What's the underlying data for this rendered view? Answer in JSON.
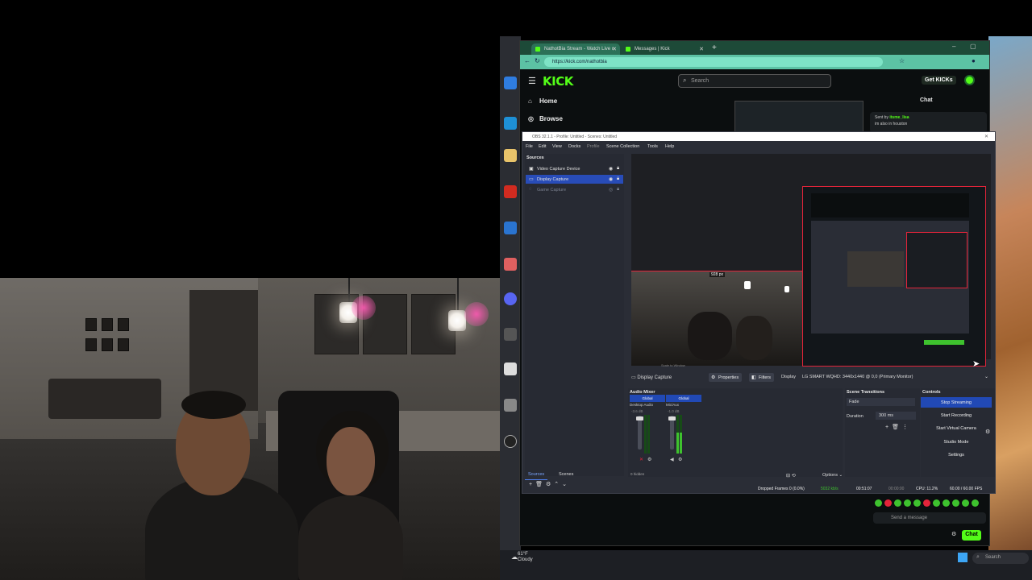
{
  "browser": {
    "tabs": [
      {
        "title": "NathotBia Stream - Watch Live o"
      },
      {
        "title": "Messages | Kick"
      }
    ],
    "url": "https://kick.com/nathotbia",
    "logo": "KICK",
    "search_placeholder": "Search",
    "get_kicks": "Get KICKs",
    "nav": [
      {
        "label": "Home",
        "icon": "home-icon"
      },
      {
        "label": "Browse",
        "icon": "compass-icon"
      }
    ],
    "chat": {
      "title": "Chat",
      "pinned_sender_prefix": "Sent by",
      "pinned_sender": "itsme_lisa",
      "pinned_message": "im also in houston",
      "input_placeholder": "Send a message",
      "chat_button": "Chat"
    }
  },
  "obs": {
    "title": "OBS 32.1.1 - Profile: Untitled - Scenes: Untitled",
    "menu": [
      "File",
      "Edit",
      "View",
      "Docks",
      "Profile",
      "Scene Collection",
      "Tools",
      "Help"
    ],
    "sources_header": "Sources",
    "sources": [
      {
        "label": "Video Capture Device",
        "selected": false,
        "dim": false
      },
      {
        "label": "Display Capture",
        "selected": true,
        "dim": false
      },
      {
        "label": "Game Capture",
        "selected": false,
        "dim": true
      }
    ],
    "preview": {
      "width_label": "928 px",
      "bottom_label": "Scale to Window"
    },
    "source_toolbar": {
      "name": "Display Capture",
      "properties": "Properties",
      "filters": "Filters",
      "display_label": "Display",
      "display_value": "LG SMART WQHD: 3440x1440 @ 0,0 (Primary Monitor)"
    },
    "audio_mixer": {
      "header": "Audio Mixer",
      "channels": [
        {
          "tag": "Global",
          "name": "Desktop Audio",
          "db": "-3.6 dB",
          "level": 0.0
        },
        {
          "tag": "Global",
          "name": "Mic/Aux",
          "db": "-1.0 dB",
          "level": 0.55
        }
      ],
      "hidden": "0 hidden",
      "options": "Options"
    },
    "scene_transitions": {
      "header": "Scene Transitions",
      "transition": "Fade",
      "duration_label": "Duration",
      "duration_value": "300 ms"
    },
    "controls": {
      "header": "Controls",
      "buttons": [
        "Stop Streaming",
        "Start Recording",
        "Start Virtual Camera",
        "Studio Mode",
        "Settings"
      ]
    },
    "tabs": [
      "Sources",
      "Scenes"
    ],
    "status": {
      "dropped": "Dropped Frames 0 (0.0%)",
      "bitrate": "5032 kb/s",
      "stream_time": "00:51:07",
      "record_time": "00:00:00",
      "cpu": "CPU: 11.2%",
      "fps": "60.00 / 60.00 FPS"
    }
  },
  "taskbar": {
    "temp": "61°F",
    "weather": "Cloudy",
    "search": "Search"
  },
  "colors": {
    "kick_green": "#53fc18",
    "obs_select": "#284cb8",
    "obs_button": "#2149b5",
    "record_red": "#e3243a"
  }
}
